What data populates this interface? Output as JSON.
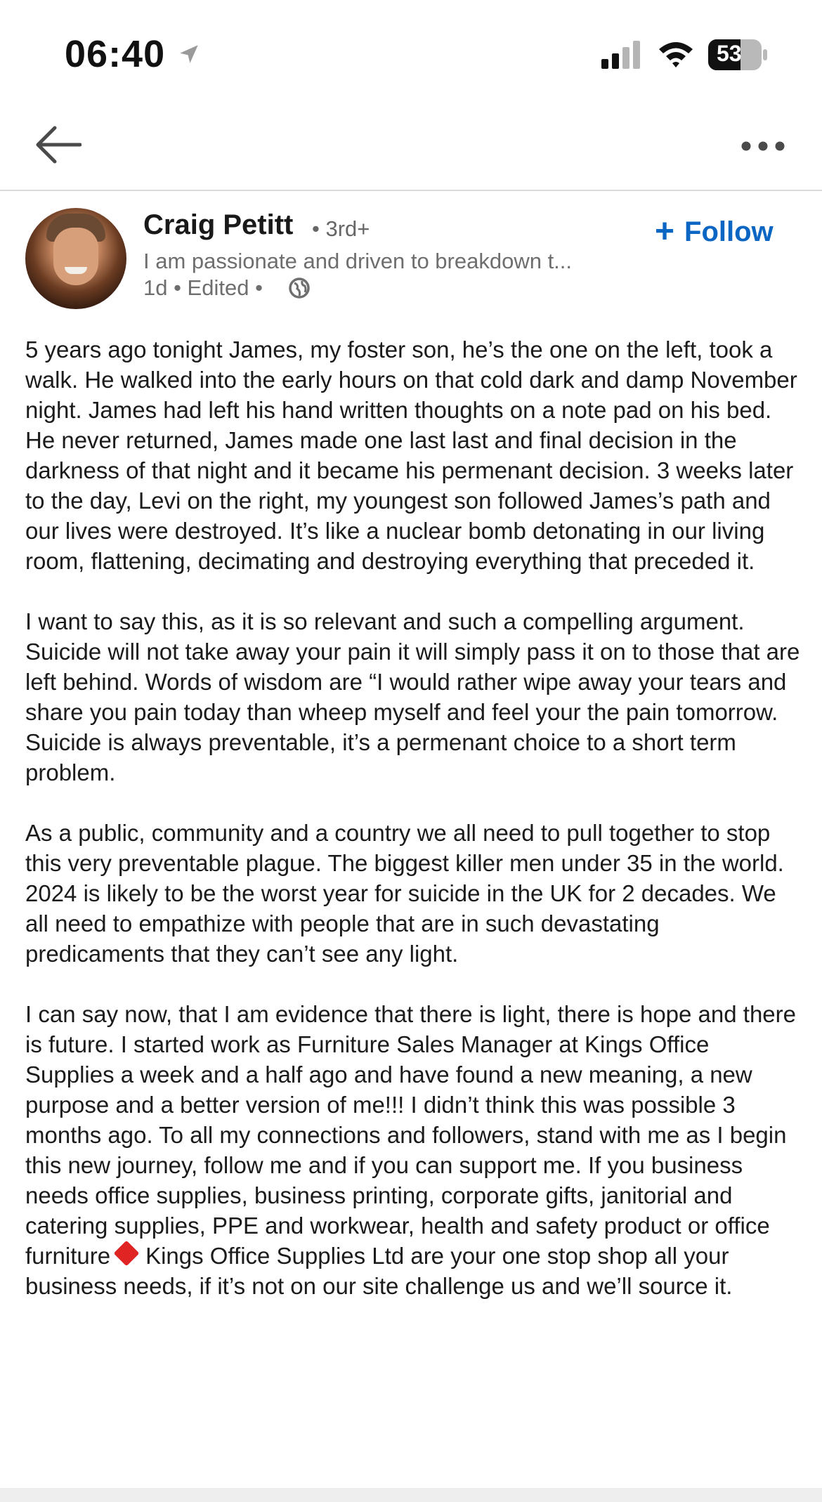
{
  "status_bar": {
    "time": "06:40",
    "battery": "53",
    "icons": [
      "location-arrow-icon",
      "cellular-signal-icon",
      "wifi-icon",
      "battery-icon"
    ]
  },
  "nav": {
    "icons": [
      "back-arrow-icon",
      "more-options-icon"
    ]
  },
  "author": {
    "name": "Craig Petitt",
    "degree": "• 3rd+",
    "headline": "I am passionate and driven to breakdown t...",
    "meta": "1d • Edited •",
    "follow_plus": "+",
    "follow_label": "Follow"
  },
  "post": {
    "p1": "5 years ago tonight James, my foster son, he’s the one on the left, took a walk.  He walked into the early hours on that cold dark and damp November night.  James had left his hand written thoughts on a note pad on his bed.  He never returned, James made one last last and final decision in the darkness of that night and it became his permenant decision.  3 weeks later to the day, Levi on the right, my youngest son followed James’s path and our lives were destroyed.  It’s like a nuclear bomb detonating in our living room, flattening, decimating and destroying everything that preceded it.",
    "p2": "I want to say this, as it is so relevant and such a compelling argument.  Suicide will not take away your pain it will simply pass it on to those that are left behind.  Words of wisdom are “I would rather wipe away your tears and share you pain today than wheep myself and feel your the pain tomorrow.  Suicide is always preventable, it’s a permenant choice to a short term problem.",
    "p3": "As a public, community and a country we all need to pull together to stop this very preventable plague.  The biggest killer men under 35 in the world.  2024 is likely to be the worst year for suicide in the UK for 2 decades.  We all need to empathize with people that are in such devastating predicaments that they can’t see any light.",
    "p4_before": "I can say now, that I am evidence that there is light, there is hope and there is future.  I started work as Furniture Sales Manager at Kings Office Supplies a week and a half ago and have found a new meaning, a new purpose and a better version of me!!!  I didn’t think this was possible 3 months ago.  To all my connections and followers, stand with me as I begin this new journey, follow me and if you can support me.  If you business needs office supplies, business printing, corporate gifts, janitorial and catering supplies, PPE and workwear, health and safety product or office furniture",
    "p4_after": "Kings Office Supplies Ltd are your one stop shop all your business needs, if it’s not on our site challenge us and we’ll source it."
  },
  "colors": {
    "accent": "#0a66c2",
    "text": "#1b1b1b",
    "muted": "#6e6e6e",
    "diamond": "#e02424"
  }
}
